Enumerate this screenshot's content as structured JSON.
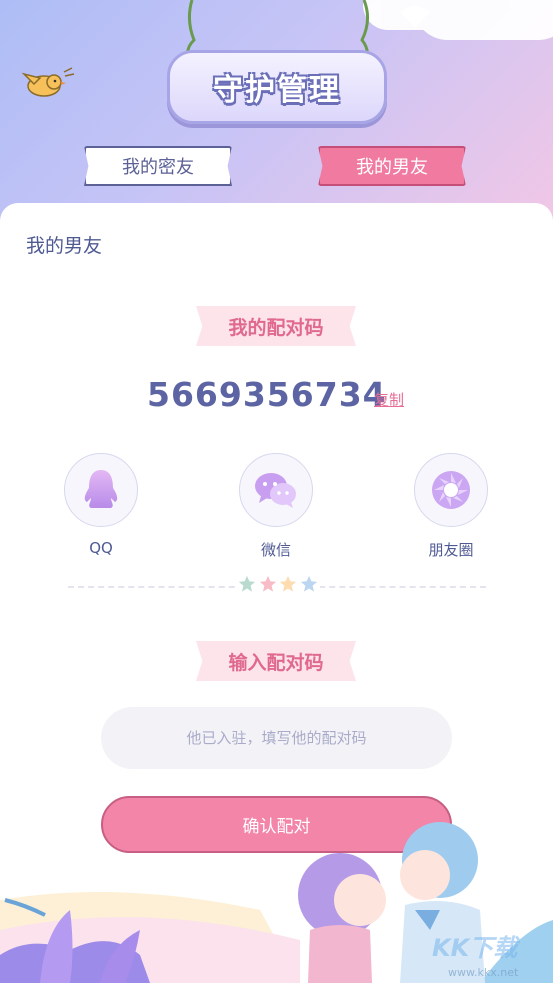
{
  "header": {
    "title": "守护管理",
    "tabs": [
      {
        "label": "我的密友",
        "active": false
      },
      {
        "label": "我的男友",
        "active": true
      }
    ]
  },
  "card": {
    "section_title": "我的男友",
    "my_code_label": "我的配对码",
    "pair_code": "5669356734",
    "copy_label": "复制",
    "share": [
      {
        "label": "QQ",
        "icon": "qq-icon"
      },
      {
        "label": "微信",
        "icon": "wechat-icon"
      },
      {
        "label": "朋友圈",
        "icon": "moments-icon"
      }
    ],
    "input_code_label": "输入配对码",
    "input_placeholder": "他已入驻，填写他的配对码",
    "confirm_label": "确认配对"
  },
  "watermark": {
    "main": "KK下载",
    "sub": "www.kkx.net"
  },
  "colors": {
    "accent_pink": "#f285a8",
    "navy_text": "#5c64a3",
    "banner_start": "#aebdf6",
    "banner_end": "#f2c7e6"
  }
}
